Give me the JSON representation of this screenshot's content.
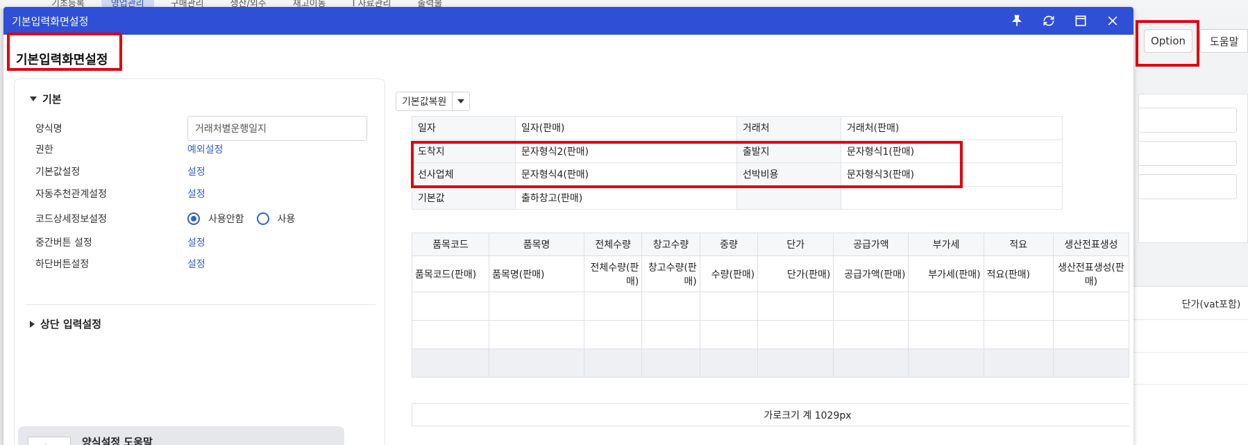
{
  "background": {
    "tabs": [
      "기초등록",
      "영업관리",
      "구매관리",
      "생산/외주",
      "재고이동",
      "I 자료관리",
      "출력물"
    ],
    "option_label": "Option",
    "help_label": "도움말",
    "table_header": "단가(vat포함)"
  },
  "modal": {
    "title": "기본입력화면설정",
    "icons": [
      "pin-icon",
      "refresh-icon",
      "maximize-icon",
      "close-icon"
    ]
  },
  "page": {
    "heading": "기본입력화면설정"
  },
  "left": {
    "section_basic": "기본",
    "rows": {
      "form_name_label": "양식명",
      "form_name_value": "거래처별운행일지",
      "permission_label": "권한",
      "permission_link": "예외설정",
      "default_label": "기본값설정",
      "default_link": "설정",
      "auto_label": "자동추천관계설정",
      "auto_link": "설정",
      "code_label": "코드상세정보설정",
      "code_opt_off": "사용안함",
      "code_opt_on": "사용",
      "middle_label": "중간버튼 설정",
      "middle_link": "설정",
      "bottom_label": "하단버튼설정",
      "bottom_link": "설정"
    },
    "section_top": "상단 입력설정",
    "help_title": "양식설정 도움말"
  },
  "right": {
    "reset_label": "기본값복원",
    "kv": [
      [
        "일자",
        "일자(판매)",
        "거래처",
        "거래처(판매)"
      ],
      [
        "도착지",
        "문자형식2(판매)",
        "출발지",
        "문자형식1(판매)"
      ],
      [
        "선사업체",
        "문자형식4(판매)",
        "선박비용",
        "문자형식3(판매)"
      ],
      [
        "기본값",
        "출하창고(판매)",
        "",
        ""
      ]
    ],
    "grid_headers": [
      "품목코드",
      "품목명",
      "전체수량",
      "창고수량",
      "중량",
      "단가",
      "공급가액",
      "부가세",
      "적요",
      "생산전표생성"
    ],
    "grid_sub": [
      "품목코드(판매)",
      "품목명(판매)",
      "전체수량(판매)",
      "창고수량(판매)",
      "수량(판매)",
      "단가(판매)",
      "공급가액(판매)",
      "부가세(판매)",
      "적요(판매)",
      "생산전표생성(판매)"
    ],
    "width_total": "가로크기 계 1029px"
  }
}
